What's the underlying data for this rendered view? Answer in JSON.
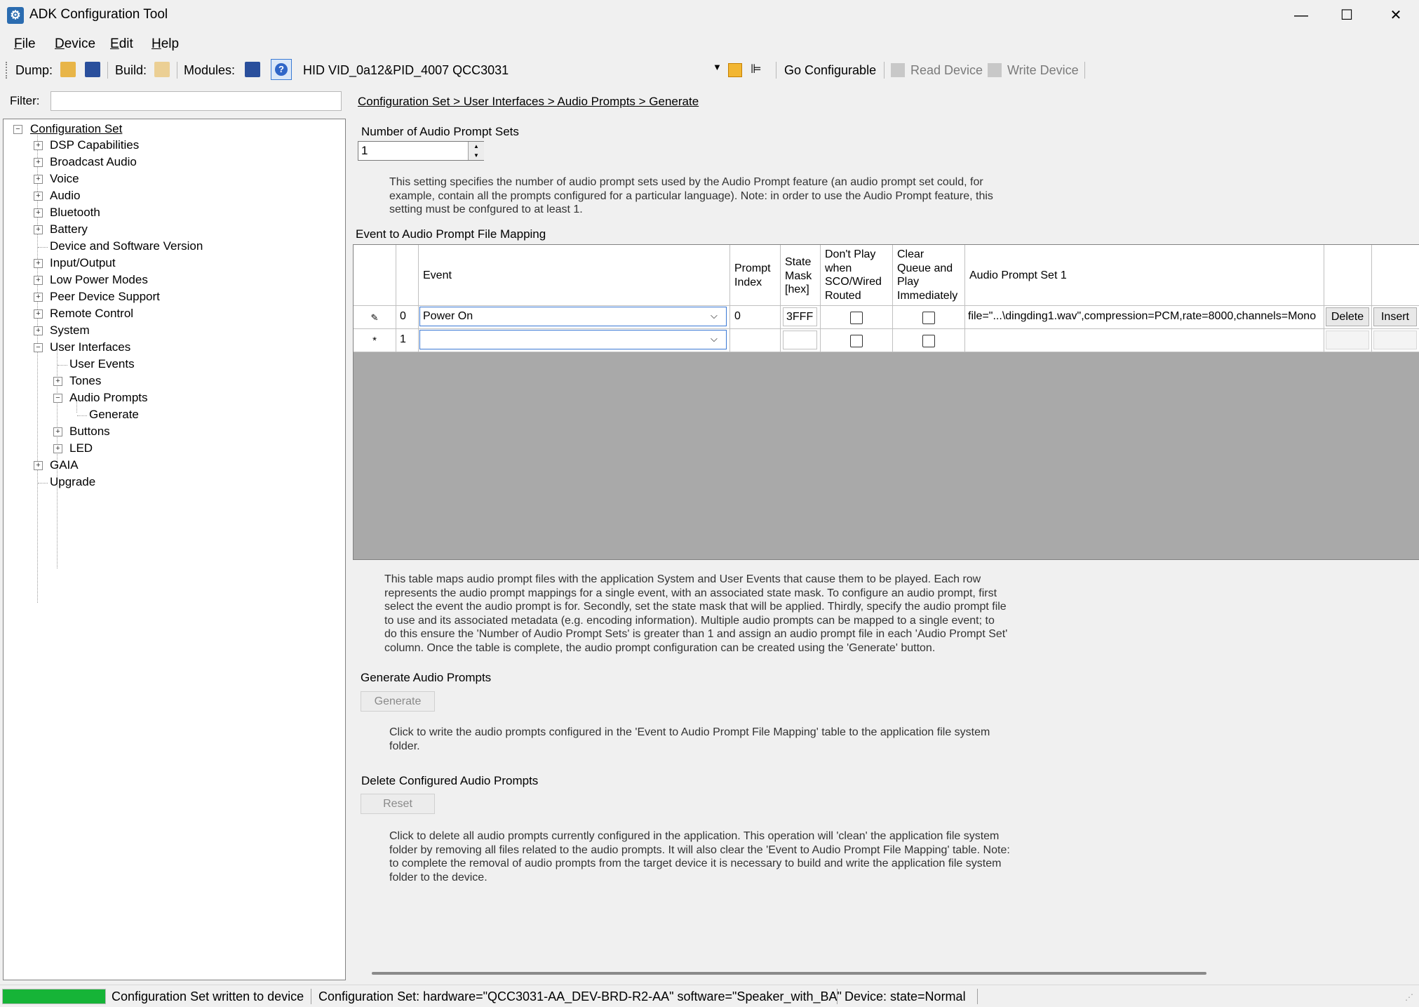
{
  "window": {
    "title": "ADK Configuration Tool",
    "controls": {
      "minimize": "—",
      "maximize": "☐",
      "close": "✕"
    }
  },
  "menu": [
    {
      "accel": "F",
      "rest": "ile"
    },
    {
      "accel": "D",
      "rest": "evice"
    },
    {
      "accel": "E",
      "rest": "dit"
    },
    {
      "accel": "H",
      "rest": "elp"
    }
  ],
  "toolbar": {
    "dump_label": "Dump:",
    "build_label": "Build:",
    "modules_label": "Modules:",
    "device_select": "HID VID_0a12&PID_4007 QCC3031",
    "go_configurable": "Go Configurable",
    "read_device": "Read Device",
    "write_device": "Write Device"
  },
  "filter": {
    "label": "Filter:",
    "value": ""
  },
  "tree": {
    "root": "Configuration Set",
    "items": [
      {
        "label": "DSP Capabilities",
        "expander": "+"
      },
      {
        "label": "Broadcast Audio",
        "expander": "+"
      },
      {
        "label": "Voice",
        "expander": "+"
      },
      {
        "label": "Audio",
        "expander": "+"
      },
      {
        "label": "Bluetooth",
        "expander": "+"
      },
      {
        "label": "Battery",
        "expander": "+"
      },
      {
        "label": "Device and Software Version",
        "expander": ""
      },
      {
        "label": "Input/Output",
        "expander": "+"
      },
      {
        "label": "Low Power Modes",
        "expander": "+"
      },
      {
        "label": "Peer Device Support",
        "expander": "+"
      },
      {
        "label": "Remote Control",
        "expander": "+"
      },
      {
        "label": "System",
        "expander": "+"
      },
      {
        "label": "User Interfaces",
        "expander": "−"
      },
      {
        "label": "User Events",
        "expander": ""
      },
      {
        "label": "Tones",
        "expander": "+"
      },
      {
        "label": "Audio Prompts",
        "expander": "−"
      },
      {
        "label": "Generate",
        "expander": ""
      },
      {
        "label": "Buttons",
        "expander": "+"
      },
      {
        "label": "LED",
        "expander": "+"
      },
      {
        "label": "GAIA",
        "expander": "+"
      },
      {
        "label": "Upgrade",
        "expander": ""
      }
    ]
  },
  "breadcrumb": "Configuration Set > User Interfaces > Audio Prompts > Generate",
  "prompt_sets": {
    "label": "Number of Audio Prompt Sets",
    "value": "1",
    "description": "This setting specifies the number of audio prompt sets used by the Audio Prompt feature (an audio prompt set could, for example, contain all the prompts configured for a particular language). Note: in order to use the Audio Prompt feature, this setting must be confgured to at least 1."
  },
  "mapping": {
    "title": "Event to Audio Prompt File Mapping",
    "headers": {
      "event": "Event",
      "prompt_index": "Prompt Index",
      "state_mask": "State Mask [hex]",
      "dont_play": "Don't Play when SCO/Wired Routed",
      "clear_queue": "Clear Queue and Play Immediately",
      "audio_set": "Audio Prompt Set 1"
    },
    "rows": [
      {
        "marker": "✎",
        "num": "0",
        "event": "Power On",
        "prompt_index": "0",
        "state_mask": "3FFF",
        "audio": "file=\"...\\dingding1.wav\",compression=PCM,rate=8000,channels=Mono",
        "delete": "Delete",
        "insert": "Insert"
      },
      {
        "marker": "*",
        "num": "1",
        "event": "",
        "prompt_index": "",
        "state_mask": "",
        "audio": ""
      }
    ],
    "description": "This table maps audio prompt files with the application System and User Events that cause them to be played. Each row represents the audio prompt mappings for a single event, with an associated state mask. To configure an audio prompt, first select the event the audio prompt is for. Secondly, set the state mask that will be applied. Thirdly, specify the audio prompt file to use and its associated metadata (e.g. encoding information). Multiple audio prompts can be mapped to a single event; to do this ensure the 'Number of Audio Prompt Sets' is greater than 1 and assign an audio prompt file in each 'Audio Prompt Set' column. Once the table is complete, the audio prompt configuration can be created using the 'Generate' button."
  },
  "generate": {
    "title": "Generate Audio Prompts",
    "button": "Generate",
    "description": "Click to write the audio prompts configured in the 'Event to Audio Prompt File Mapping' table to the application file system folder."
  },
  "delete": {
    "title": "Delete Configured Audio Prompts",
    "button": "Reset",
    "description": "Click to delete all audio prompts currently configured in the application. This operation will 'clean' the application file system folder by removing all files related to the audio prompts. It will also clear the 'Event to Audio Prompt File Mapping' table. Note: to complete the removal of audio prompts from the target device it is necessary to build and write the application file system folder to the device."
  },
  "status": {
    "progress": 1.0,
    "progress_color": "#16b437",
    "message": "Configuration Set written to device",
    "config_set": "Configuration Set:  hardware=\"QCC3031-AA_DEV-BRD-R2-AA\" software=\"Speaker_with_BA\"",
    "device": "Device:  state=Normal"
  },
  "icons": [
    "app-icon",
    "open-folder-icon",
    "save-disk-icon",
    "build-folder-icon",
    "modules-save-icon",
    "help-icon",
    "dropdown-arrow-icon",
    "device-plug-icon",
    "device-tool-icon",
    "read-device-icon",
    "write-device-icon",
    "spinner-up-icon",
    "spinner-down-icon",
    "edit-pencil-icon",
    "new-row-icon",
    "resize-grip-icon"
  ]
}
